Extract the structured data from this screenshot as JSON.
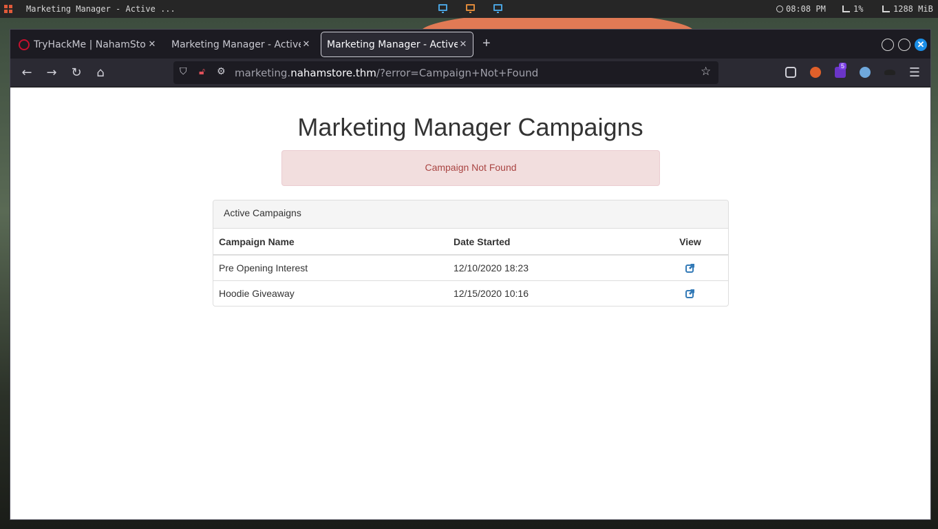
{
  "system_bar": {
    "window_title": "Marketing Manager - Active ...",
    "clock": "08:08 PM",
    "cpu": "1%",
    "memory": "1288 MiB"
  },
  "browser": {
    "tabs": [
      {
        "label": "TryHackMe | NahamStore",
        "active": false
      },
      {
        "label": "Marketing Manager - Active",
        "active": false
      },
      {
        "label": "Marketing Manager - Active",
        "active": true
      }
    ],
    "new_tab_symbol": "+",
    "url": {
      "subdomain": "marketing.",
      "domain": "nahamstore.thm",
      "path": "/?error=Campaign+Not+Found"
    },
    "extension_badge": "5",
    "colors": {
      "accent": "#1b8fe8",
      "tab_bar": "#1c1b22",
      "nav_bar": "#2b2a33"
    }
  },
  "page": {
    "title": "Marketing Manager Campaigns",
    "alert": "Campaign Not Found",
    "panel_heading": "Active Campaigns",
    "table": {
      "headers": [
        "Campaign Name",
        "Date Started",
        "View"
      ],
      "rows": [
        {
          "name": "Pre Opening Interest",
          "date": "12/10/2020 18:23",
          "view_icon": "external-link-icon"
        },
        {
          "name": "Hoodie Giveaway",
          "date": "12/15/2020 10:16",
          "view_icon": "external-link-icon"
        }
      ]
    },
    "colors": {
      "alert_bg": "#f2dede",
      "alert_text": "#a94442",
      "link": "#337ab7"
    }
  }
}
